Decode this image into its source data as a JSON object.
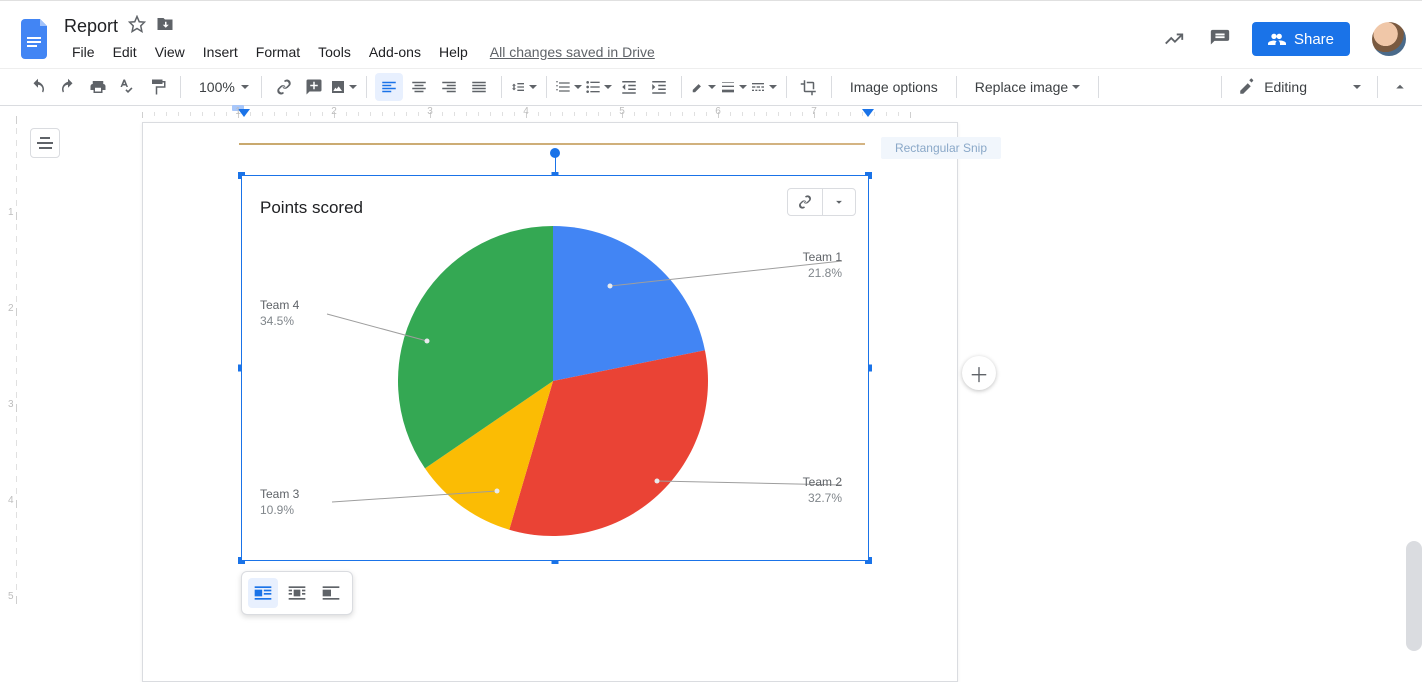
{
  "doc": {
    "title": "Report",
    "saved_text": "All changes saved in Drive"
  },
  "menus": [
    "File",
    "Edit",
    "View",
    "Insert",
    "Format",
    "Tools",
    "Add-ons",
    "Help"
  ],
  "header": {
    "share_label": "Share"
  },
  "toolbar": {
    "zoom": "100%",
    "image_options": "Image options",
    "replace_image": "Replace image",
    "editing": "Editing"
  },
  "snip_hint": "Rectangular Snip",
  "chart_data": {
    "type": "pie",
    "title": "Points scored",
    "series": [
      {
        "name": "Team 1",
        "value": 21.8,
        "pct_label": "21.8%",
        "color": "#4285F4"
      },
      {
        "name": "Team 2",
        "value": 32.7,
        "pct_label": "32.7%",
        "color": "#EA4335"
      },
      {
        "name": "Team 3",
        "value": 10.9,
        "pct_label": "10.9%",
        "color": "#FBBC04"
      },
      {
        "name": "Team 4",
        "value": 34.5,
        "pct_label": "34.5%",
        "color": "#34A853"
      }
    ]
  },
  "ruler": {
    "labels": [
      "1",
      "2",
      "3",
      "4",
      "5",
      "6",
      "7"
    ]
  },
  "vruler": {
    "labels": [
      "1",
      "2",
      "3",
      "4",
      "5"
    ]
  }
}
